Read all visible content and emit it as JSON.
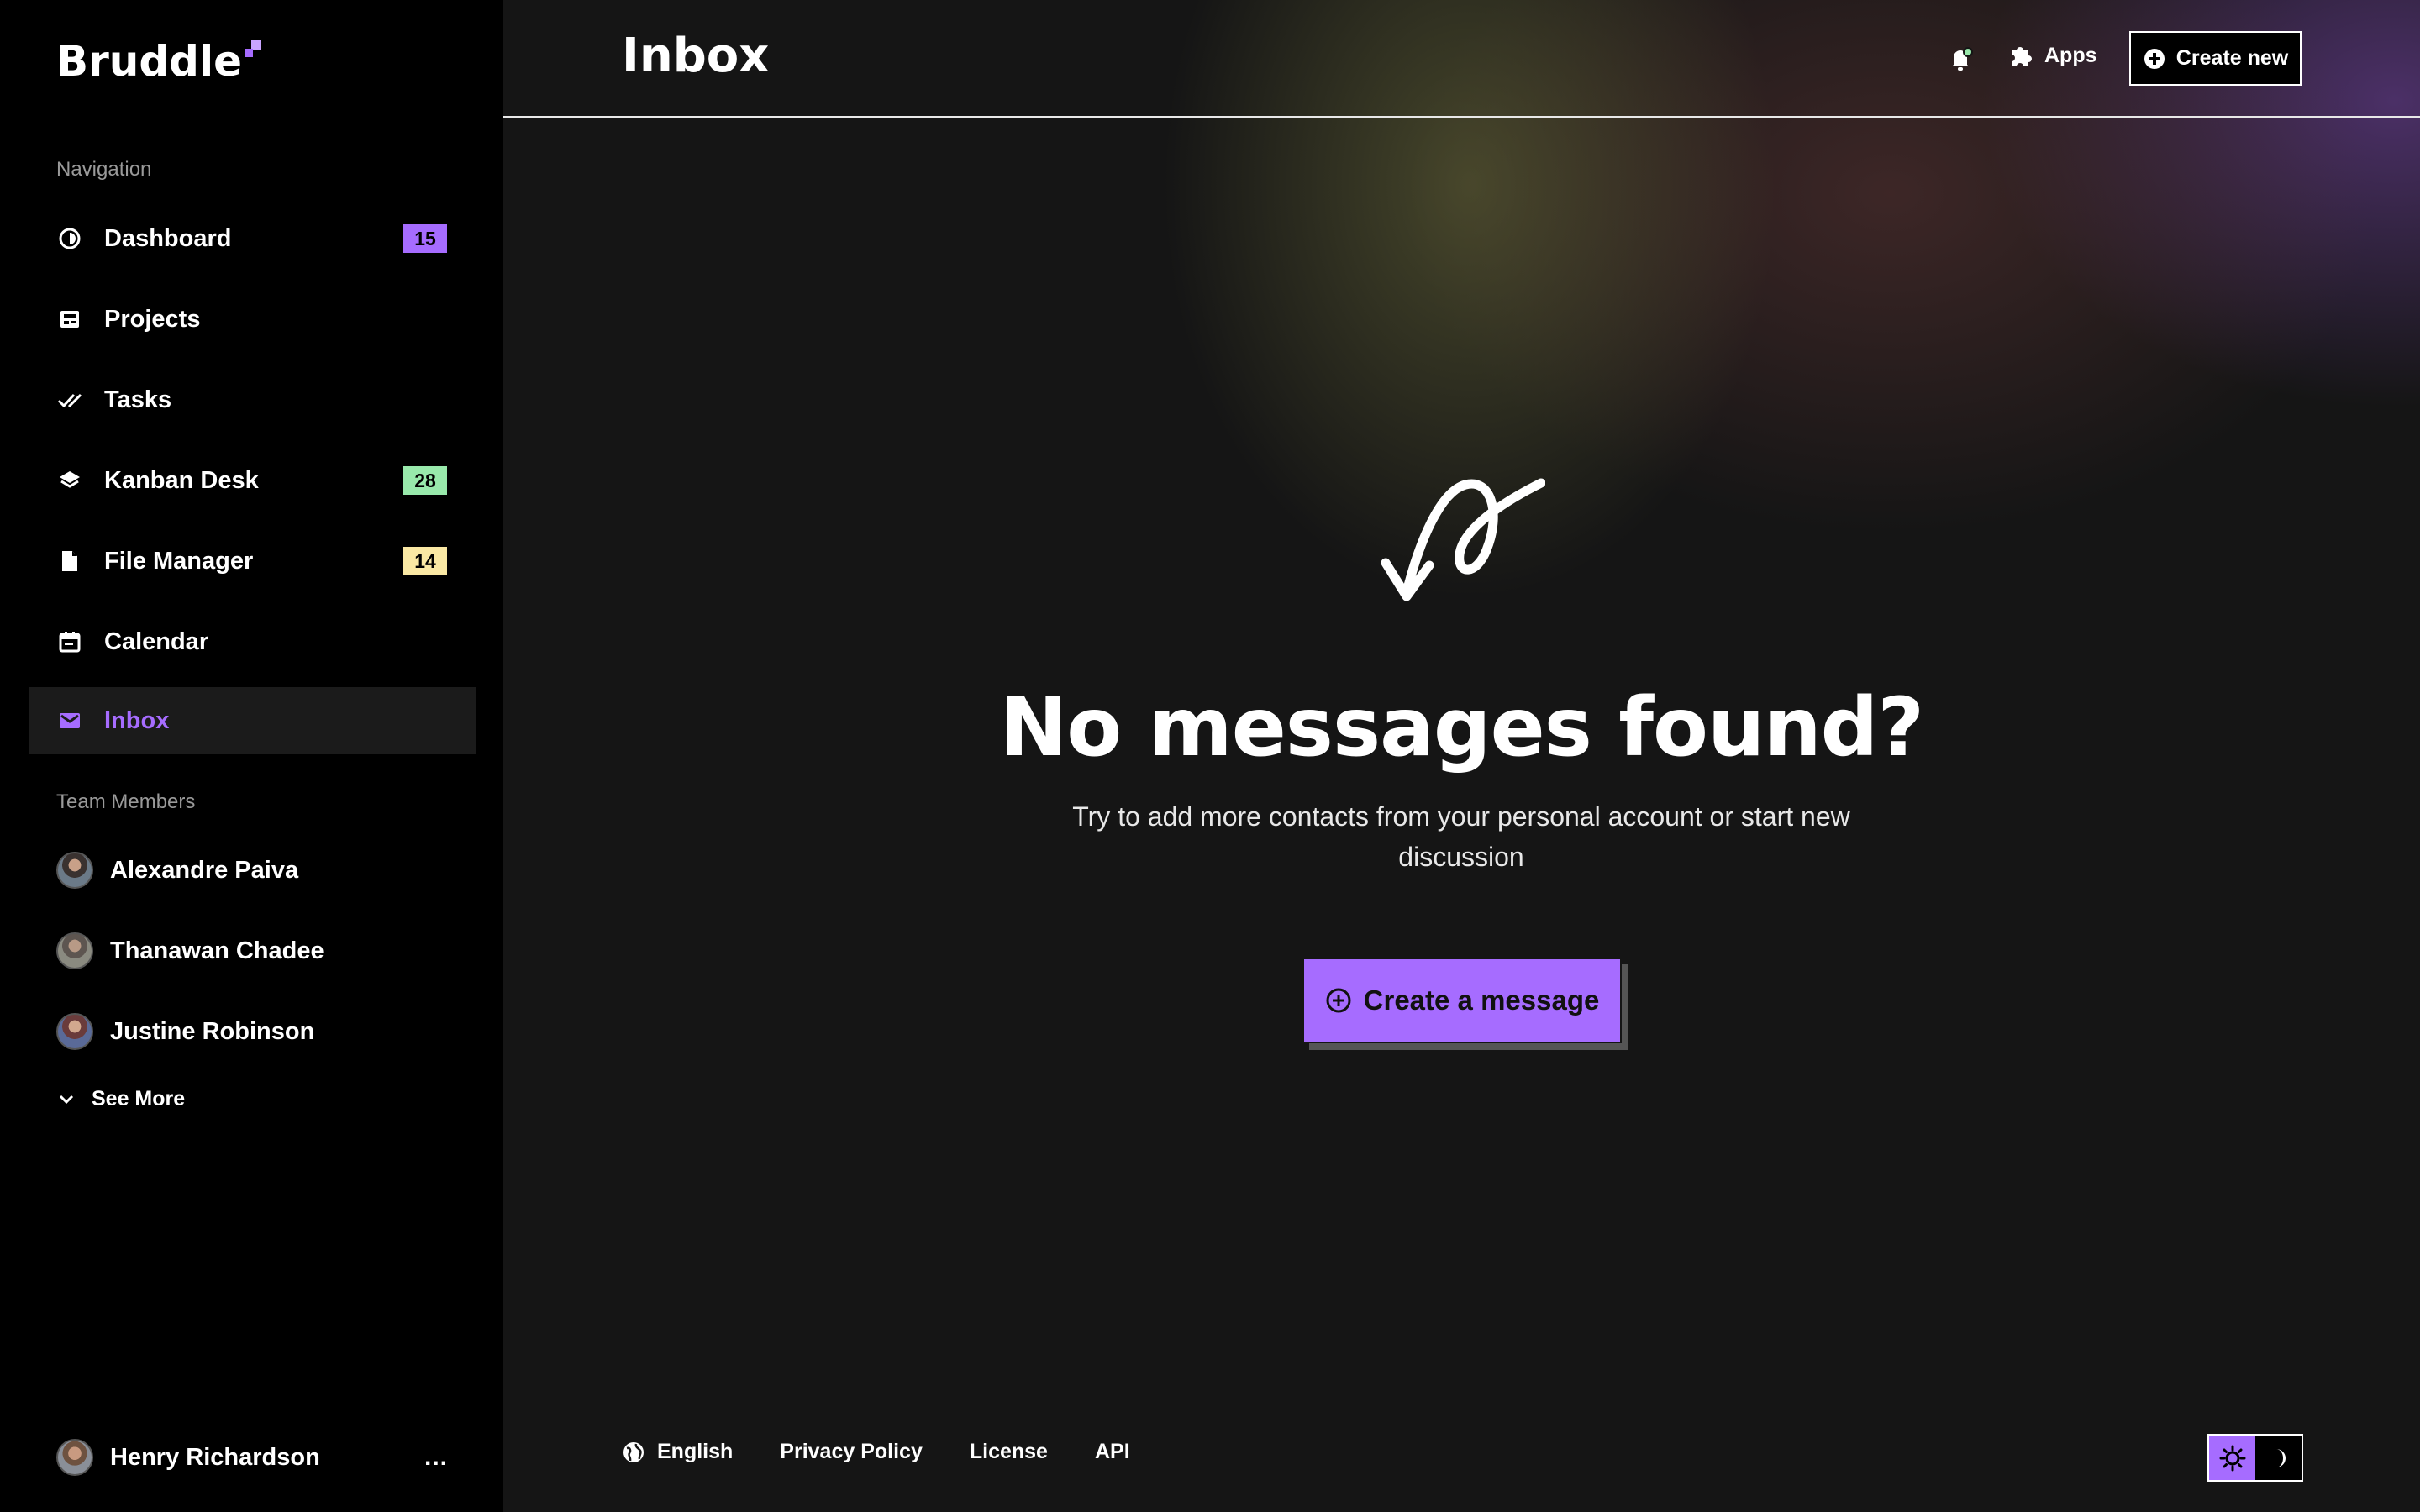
{
  "app": {
    "name": "Bruddle"
  },
  "colors": {
    "accent": "#a66cff",
    "badge_purple": "#a66cff",
    "badge_green": "#98e9ab",
    "badge_yellow": "#fae8a4",
    "notification_dot": "#98e9ab"
  },
  "sidebar": {
    "nav_label": "Navigation",
    "items": [
      {
        "label": "Dashboard",
        "icon": "dashboard-icon",
        "badge": "15"
      },
      {
        "label": "Projects",
        "icon": "projects-icon",
        "badge": ""
      },
      {
        "label": "Tasks",
        "icon": "double-check-icon",
        "badge": ""
      },
      {
        "label": "Kanban Desk",
        "icon": "layers-icon",
        "badge": "28"
      },
      {
        "label": "File Manager",
        "icon": "file-icon",
        "badge": "14"
      },
      {
        "label": "Calendar",
        "icon": "calendar-icon",
        "badge": ""
      },
      {
        "label": "Inbox",
        "icon": "mail-icon",
        "badge": "",
        "active": true
      }
    ],
    "team_label": "Team Members",
    "members": [
      {
        "name": "Alexandre Paiva"
      },
      {
        "name": "Thanawan Chadee"
      },
      {
        "name": "Justine Robinson"
      }
    ],
    "see_more": "See More",
    "current_user": {
      "name": "Henry Richardson",
      "menu": "..."
    }
  },
  "header": {
    "title": "Inbox",
    "apps_label": "Apps",
    "create_new_label": "Create new"
  },
  "empty_state": {
    "headline": "No messages found?",
    "description": "Try to add more contacts from your personal account or start new discussion",
    "cta_label": "Create a message"
  },
  "footer": {
    "language": "English",
    "links": [
      "Privacy Policy",
      "License",
      "API"
    ]
  }
}
